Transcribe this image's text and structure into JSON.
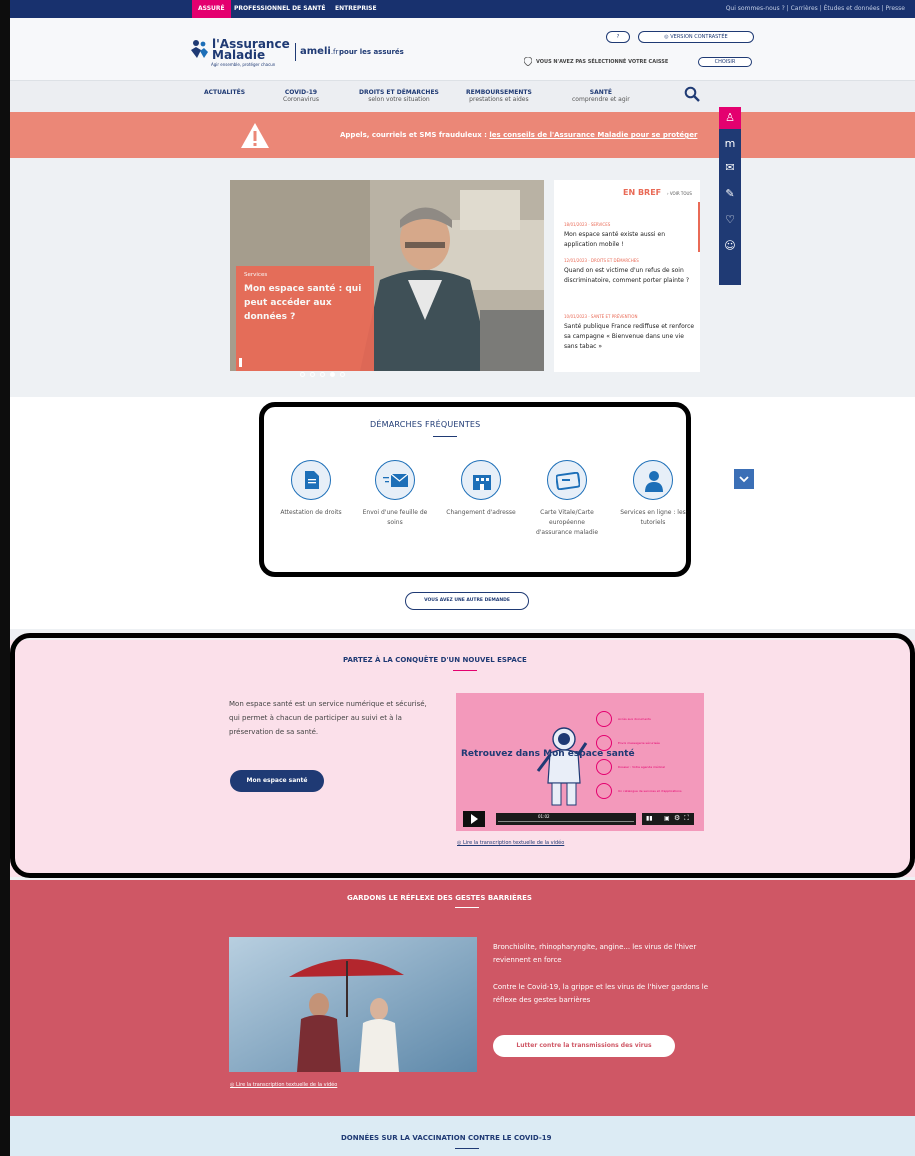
{
  "topbar": {
    "audience_assure": "ASSURÉ",
    "audience_pro": "PROFESSIONNEL DE SANTÉ",
    "audience_entreprise": "ENTREPRISE",
    "links": "Qui sommes-nous ?  |  Carrières  |  Études et données  |  Presse"
  },
  "header": {
    "logo_line1": "l'Assurance",
    "logo_line2": "Maladie",
    "logo_tagline": "Agir ensemble, protéger chacun",
    "ameli": "ameli",
    "ameli_tld": ".fr",
    "assures": "pour les assurés",
    "help_label": "?",
    "contrast_label": "VERSION CONTRASTÉE",
    "caisse_text": "VOUS N'AVEZ PAS SÉLECTIONNÉ VOTRE CAISSE",
    "choose_label": "CHOISIR"
  },
  "nav": {
    "items": [
      {
        "l1": "ACTUALITÉS",
        "l2": ""
      },
      {
        "l1": "COVID-19",
        "l2": "Coronavirus"
      },
      {
        "l1": "DROITS ET DÉMARCHES",
        "l2": "selon votre situation"
      },
      {
        "l1": "REMBOURSEMENTS",
        "l2": "prestations et aides"
      },
      {
        "l1": "SANTÉ",
        "l2": "comprendre et agir"
      }
    ]
  },
  "alert": {
    "text": "Appels, courriels et SMS frauduleux : ",
    "link": "les conseils de l'Assurance Maladie pour se protéger"
  },
  "hero": {
    "category": "Services",
    "title": "Mon espace santé : qui peut accéder aux données ?"
  },
  "brief": {
    "heading": "EN BREF",
    "see_all": "› VOIR TOUS",
    "news": [
      {
        "meta": "18/01/2023 · SERVICES",
        "title": "Mon espace santé existe aussi en application mobile !"
      },
      {
        "meta": "12/01/2023 · DROITS ET DÉMARCHES",
        "title": "Quand on est victime d'un refus de soin discriminatoire, comment porter plainte ?"
      },
      {
        "meta": "10/01/2023 · SANTÉ ET PRÉVENTION",
        "title": "Santé publique France rediffuse et renforce sa campagne « Bienvenue dans une vie sans tabac »"
      }
    ]
  },
  "demarches": {
    "title": "DÉMARCHES FRÉQUENTES",
    "items": [
      {
        "label": "Attestation de droits",
        "icon": "document-icon"
      },
      {
        "label": "Envoi d'une feuille de soins",
        "icon": "envelope-send-icon"
      },
      {
        "label": "Changement d'adresse",
        "icon": "building-icon"
      },
      {
        "label": "Carte Vitale/Carte européenne d'assurance maladie",
        "icon": "card-icon"
      },
      {
        "label": "Services en ligne : les tutoriels",
        "icon": "person-icon"
      }
    ],
    "other_label": "VOUS AVEZ UNE AUTRE DEMANDE"
  },
  "mon_espace": {
    "title": "PARTEZ À LA CONQUÊTE D'UN NOUVEL ESPACE",
    "text": "Mon espace santé est un service numérique et sécurisé, qui permet à chacun de participer au suivi et à la préservation de sa santé.",
    "button": "Mon espace santé",
    "video_heading": "Retrouvez dans Mon espace santé",
    "features": [
      "Accès aux documents",
      "Envoi messagerie sécurisée",
      "Dossier : Votre agenda médical",
      "Un catalogue de services et d'applications"
    ],
    "video_time": "01:02",
    "transcript": "Lire la transcription textuelle de la vidéo"
  },
  "barrier": {
    "title": "GARDONS LE RÉFLEXE DES GESTES BARRIÈRES",
    "p1": "Bronchiolite, rhinopharyngite, angine... les virus de l'hiver reviennent en force",
    "p2": "Contre le Covid-19, la grippe et les virus de l'hiver gardons le réflexe des gestes barrières",
    "button": "Lutter contre la transmissions des virus",
    "transcript": "Lire la transcription textuelle de la vidéo"
  },
  "vaccination": {
    "title": "DONNÉES SUR LA VACCINATION CONTRE LE COVID-19"
  },
  "colors": {
    "navy": "#1f3a74",
    "pink": "#e4006f",
    "coral": "#eb8777",
    "barrier": "#cf5765"
  }
}
